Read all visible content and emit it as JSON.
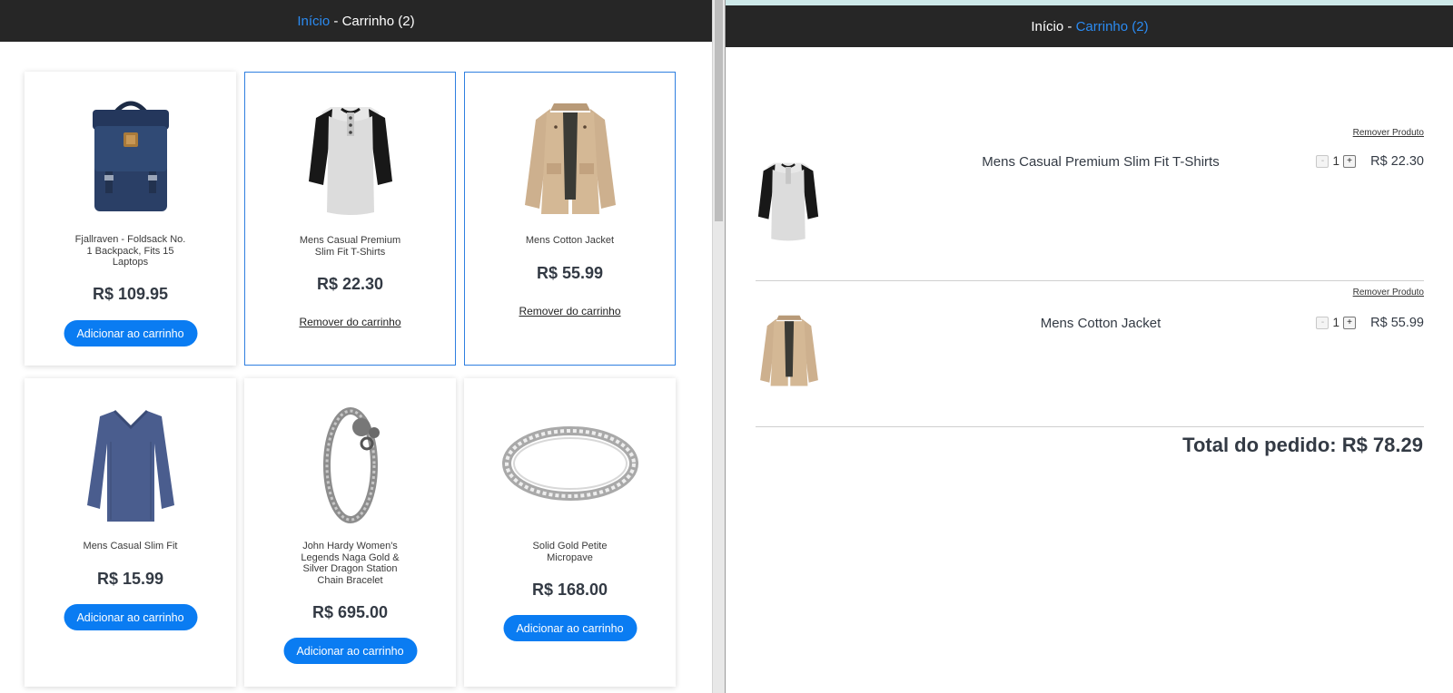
{
  "left": {
    "header": {
      "home": "Início",
      "separator": " - ",
      "cart": "Carrinho (2)"
    },
    "products": [
      {
        "title": "Fjallraven - Foldsack No. 1 Backpack, Fits 15 Laptops",
        "price": "R$ 109.95",
        "action": "Adicionar ao carrinho",
        "in_cart": false,
        "image": "backpack-image"
      },
      {
        "title": "Mens Casual Premium Slim Fit T-Shirts",
        "price": "R$ 22.30",
        "action": "Remover do carrinho",
        "in_cart": true,
        "image": "raglan-tshirt-image"
      },
      {
        "title": "Mens Cotton Jacket",
        "price": "R$ 55.99",
        "action": "Remover do carrinho",
        "in_cart": true,
        "image": "cotton-jacket-image"
      },
      {
        "title": "Mens Casual Slim Fit",
        "price": "R$ 15.99",
        "action": "Adicionar ao carrinho",
        "in_cart": false,
        "image": "long-sleeve-shirt-image"
      },
      {
        "title": "John Hardy Women's Legends Naga Gold & Silver Dragon Station Chain Bracelet",
        "price": "R$ 695.00",
        "action": "Adicionar ao carrinho",
        "in_cart": false,
        "image": "dragon-bracelet-image"
      },
      {
        "title": "Solid Gold Petite Micropave",
        "price": "R$ 168.00",
        "action": "Adicionar ao carrinho",
        "in_cart": false,
        "image": "ring-image"
      }
    ]
  },
  "right": {
    "header": {
      "home": "Início",
      "separator": " - ",
      "cart": "Carrinho (2)"
    },
    "cart_items": [
      {
        "name": "Mens Casual Premium Slim Fit T-Shirts",
        "remove_label": "Remover Produto",
        "decrement": "-",
        "quantity": "1",
        "increment": "+",
        "price": "R$ 22.30",
        "image": "raglan-tshirt-image"
      },
      {
        "name": "Mens Cotton Jacket",
        "remove_label": "Remover Produto",
        "decrement": "-",
        "quantity": "1",
        "increment": "+",
        "price": "R$ 55.99",
        "image": "cotton-jacket-image"
      }
    ],
    "total": "Total do pedido: R$ 78.29"
  },
  "colors": {
    "header_bg": "#262626",
    "link_blue": "#2b8bf2",
    "button_blue": "#0a7cf2",
    "card_border": "#2f7fe0",
    "text_dark": "#333a44"
  }
}
